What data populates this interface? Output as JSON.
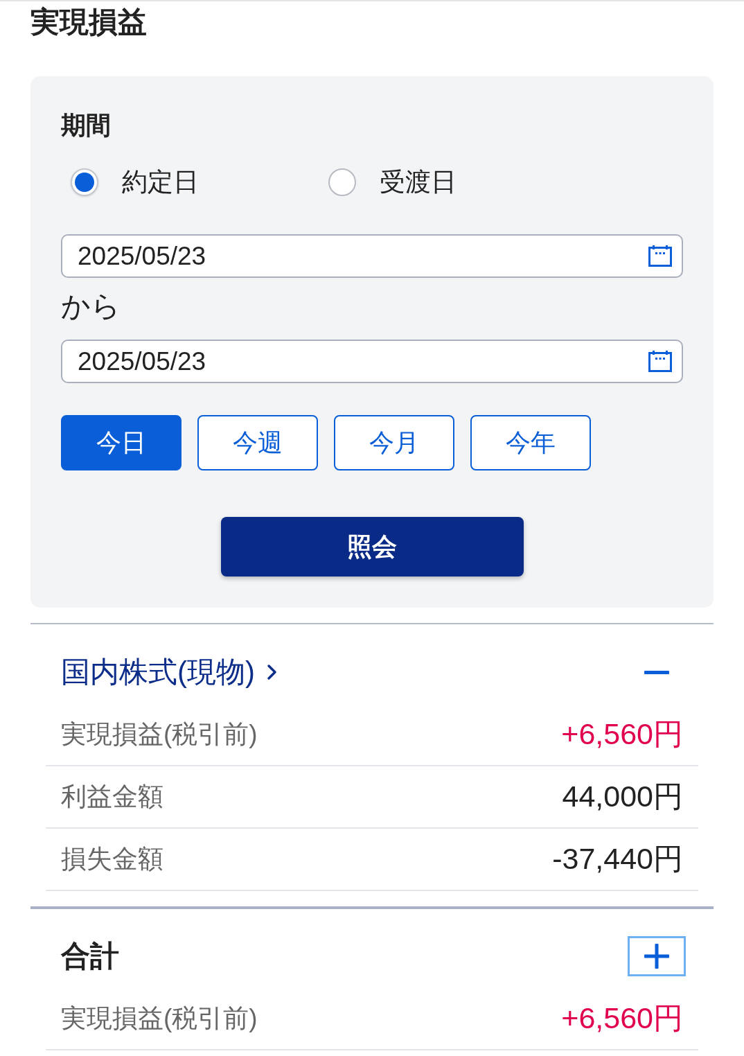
{
  "page": {
    "title": "実現損益"
  },
  "period": {
    "label": "期間",
    "date_types": [
      {
        "label": "約定日",
        "selected": true
      },
      {
        "label": "受渡日",
        "selected": false
      }
    ],
    "from_date": {
      "value": "2025/05/23"
    },
    "range_separator": "から",
    "to_date": {
      "value": "2025/05/23"
    },
    "quick_ranges": [
      {
        "label": "今日",
        "selected": true
      },
      {
        "label": "今週",
        "selected": false
      },
      {
        "label": "今月",
        "selected": false
      },
      {
        "label": "今年",
        "selected": false
      }
    ],
    "submit_button": "照会"
  },
  "sections": [
    {
      "kind": "category",
      "title": "国内株式(現物)",
      "expanded": true,
      "focused": false,
      "rows": [
        {
          "kind": "gain",
          "label": "実現損益(税引前)",
          "value": "+6,560円"
        },
        {
          "kind": "amount",
          "label": "利益金額",
          "value": "44,000円"
        },
        {
          "kind": "amount",
          "label": "損失金額",
          "value": "-37,440円"
        }
      ]
    },
    {
      "kind": "total",
      "title": "合計",
      "expanded": false,
      "focused": true,
      "rows": [
        {
          "kind": "gain",
          "label": "実現損益(税引前)",
          "value": "+6,560円"
        }
      ]
    }
  ]
}
